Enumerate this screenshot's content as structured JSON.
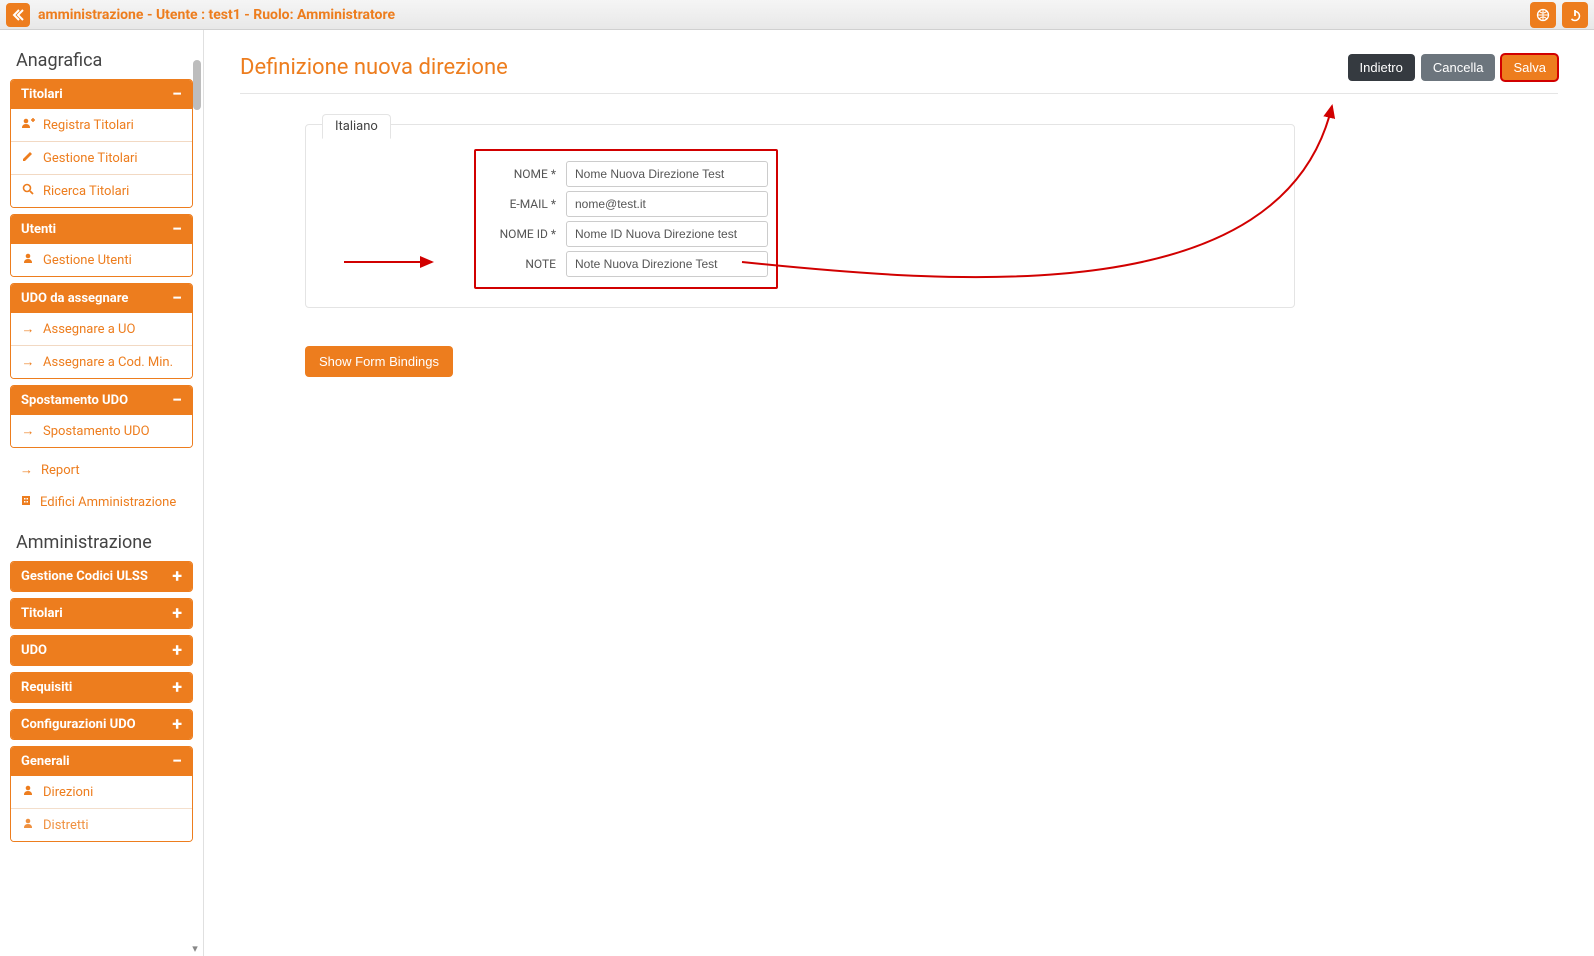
{
  "header": {
    "title": "amministrazione - Utente : test1 - Ruolo: Amministratore"
  },
  "sidebar": {
    "section1_title": "Anagrafica",
    "panel_titolari": {
      "title": "Titolari",
      "items": [
        "Registra Titolari",
        "Gestione Titolari",
        "Ricerca Titolari"
      ]
    },
    "panel_utenti": {
      "title": "Utenti",
      "items": [
        "Gestione Utenti"
      ]
    },
    "panel_udo_assegnare": {
      "title": "UDO da assegnare",
      "items": [
        "Assegnare a UO",
        "Assegnare a Cod. Min."
      ]
    },
    "panel_spostamento": {
      "title": "Spostamento UDO",
      "items": [
        "Spostamento UDO"
      ]
    },
    "loose_items": [
      "Report",
      "Edifici Amministrazione"
    ],
    "section2_title": "Amministrazione",
    "collapsed_panels": [
      "Gestione Codici ULSS",
      "Titolari",
      "UDO",
      "Requisiti",
      "Configurazioni UDO"
    ],
    "panel_generali": {
      "title": "Generali",
      "items": [
        "Direzioni",
        "Distretti"
      ]
    }
  },
  "page": {
    "title": "Definizione nuova direzione",
    "buttons": {
      "back": "Indietro",
      "cancel": "Cancella",
      "save": "Salva"
    },
    "tab": "Italiano",
    "form": {
      "nome_label": "NOME *",
      "nome_value": "Nome Nuova Direzione Test",
      "email_label": "E-MAIL *",
      "email_value": "nome@test.it",
      "nomeid_label": "NOME ID *",
      "nomeid_value": "Nome ID Nuova Direzione test",
      "note_label": "NOTE",
      "note_value": "Note Nuova Direzione Test"
    },
    "show_bindings": "Show Form Bindings"
  }
}
